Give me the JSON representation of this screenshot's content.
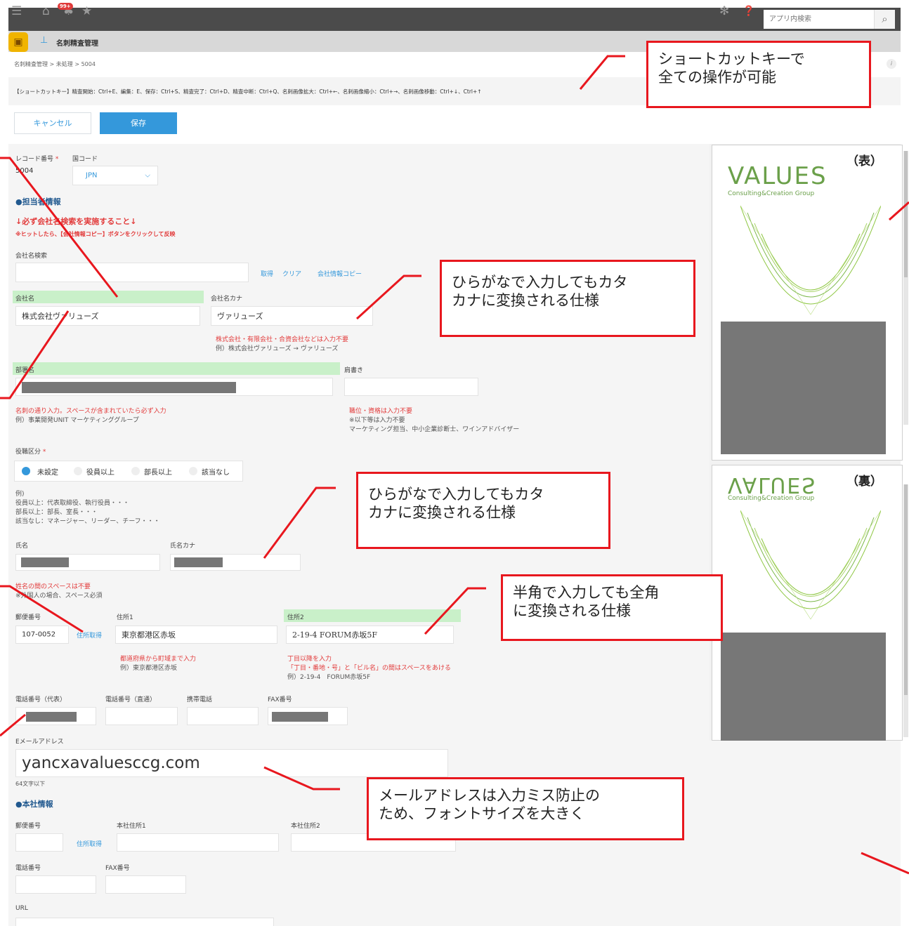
{
  "topbar": {
    "badge": "99+",
    "search_placeholder": "アプリ内検索"
  },
  "app": {
    "title": "名刺精査管理"
  },
  "breadcrumb": {
    "text": "名刺精査管理 > 未処理 > 5004"
  },
  "shortcut_bar": {
    "text": "【ショートカットキー】精査開始：Ctrl+E、編集：E、保存：Ctrl+S、精査完了：Ctrl+D、精査中断：Ctrl+Q、名刺画像拡大：Ctrl+←、名刺画像縮小：Ctrl+→、名刺画像移動：Ctrl+↓、Ctrl+↑"
  },
  "actions": {
    "cancel": "キャンセル",
    "save": "保存"
  },
  "record": {
    "label": "レコード番号",
    "value": "5004",
    "required": "*"
  },
  "country": {
    "label": "国コード",
    "value": "JPN"
  },
  "sections": {
    "contact": "●担当者情報",
    "hq": "●本社情報"
  },
  "warning": {
    "line1": "↓必ず会社名検索を実施すること↓",
    "line2": "※ヒットしたら、【会社情報コピー】ボタンをクリックして反映"
  },
  "company_search": {
    "label": "会社名検索",
    "get": "取得",
    "clear": "クリア",
    "copy": "会社情報コピー"
  },
  "company": {
    "label": "会社名",
    "value": "株式会社ヴァリューズ",
    "kana_label": "会社名カナ",
    "kana_value": "ヴァリューズ",
    "note1": "株式会社・有限会社・合資会社などは入力不要",
    "note2": "例）株式会社ヴァリューズ → ヴァリューズ"
  },
  "dept": {
    "label": "部署名",
    "note1": "名刺の通り入力。スペースが含まれていたら必ず入力",
    "note2": "例）事業開発UNIT マーケティンググループ"
  },
  "title_field": {
    "label": "肩書き",
    "note1": "職位・資格は入力不要",
    "note2": "※以下等は入力不要",
    "note3": "マーケティング担当、中小企業診断士、ワインアドバイザー"
  },
  "position": {
    "label": "役職区分",
    "required": "*",
    "options": [
      "未設定",
      "役員以上",
      "部長以上",
      "該当なし"
    ],
    "examples": [
      "例)",
      "役員以上：代表取締役、執行役員・・・",
      "部長以上：部長、室長・・・",
      "該当なし：マネージャー、リーダー、チーフ・・・"
    ]
  },
  "name": {
    "label": "氏名",
    "kana_label": "氏名カナ",
    "note1": "姓名の間のスペースは不要",
    "note2": "※外国人の場合、スペース必須"
  },
  "address": {
    "zip_label": "郵便番号",
    "zip_value": "107-0052",
    "lookup": "住所取得",
    "addr1_label": "住所1",
    "addr1_value": "東京都港区赤坂",
    "addr2_label": "住所2",
    "addr2_value": "2-19-4 FORUM赤坂5F",
    "note1a": "都道府県から町域まで入力",
    "note1b": "例）東京都港区赤坂",
    "note2a": "丁目以降を入力",
    "note2b": "「丁目・番地・号」と「ビル名」の間はスペースをあける",
    "note2c": "例）2-19-4　FORUM赤坂5F"
  },
  "phones": {
    "main": "電話番号（代表）",
    "direct": "電話番号（直通）",
    "mobile": "携帯電話",
    "fax": "FAX番号"
  },
  "email": {
    "label": "Eメールアドレス",
    "value": "yancxavaluesccg.com",
    "note": "64文字以下"
  },
  "hq": {
    "zip": "郵便番号",
    "lookup": "住所取得",
    "addr1": "本社住所1",
    "addr2": "本社住所2",
    "phone": "電話番号",
    "fax": "FAX番号",
    "url": "URL"
  },
  "card_front": {
    "side": "（表）",
    "logo": "VALUES",
    "sub": "Consulting&Creation Group"
  },
  "card_back": {
    "side": "（裏）",
    "logo": "VALUES",
    "sub": "Consulting&Creation Group"
  },
  "callouts": {
    "shortcut": "ショートカットキーで\n全ての操作が可能",
    "kana1": "ひらがなで入力してもカタ\nカナに変換される仕様",
    "kana2": "ひらがなで入力してもカタ\nカナに変換される仕様",
    "fullwidth": "半角で入力しても全角\nに変換される仕様",
    "email": "メールアドレスは入力ミス防止の\nため、フォントサイズを大きく"
  },
  "colors": {
    "accent": "#3498db",
    "callout_border": "#e8171e",
    "warning": "#e23b3b",
    "required_bg": "#c9f0c9"
  }
}
